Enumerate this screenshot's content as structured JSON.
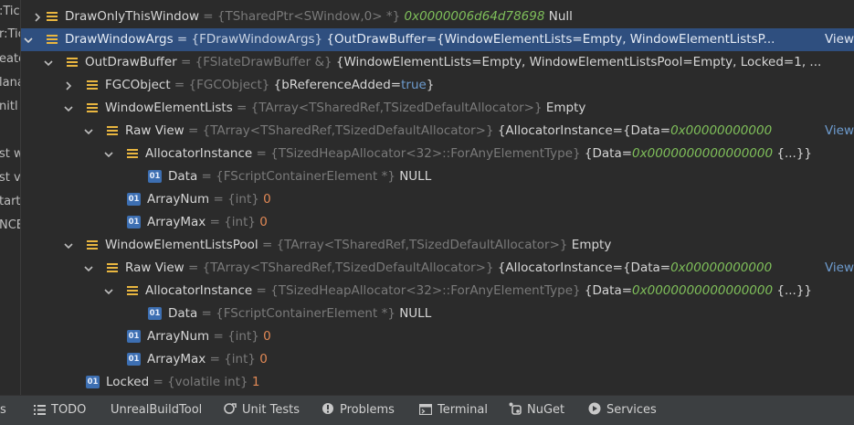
{
  "gutter": [
    ":Tic",
    "r:Tic",
    "eate",
    "lana",
    "nitl",
    "st w",
    "st v",
    "tart",
    "NCE"
  ],
  "rows": [
    {
      "id": "r0",
      "name": "DrawOnlyThisWindow",
      "type": "{TSharedPtr<SWindow,0> *}",
      "addr": "0x0000006d64d78698",
      "value": " Null"
    },
    {
      "id": "r1",
      "name": "DrawWindowArgs",
      "type": "{FDrawWindowArgs}",
      "value": " {OutDrawBuffer={WindowElementLists=Empty, WindowElementListsP...",
      "link": "View"
    },
    {
      "id": "r2",
      "name": "OutDrawBuffer",
      "type": "{FSlateDrawBuffer &}",
      "value": " {WindowElementLists=Empty, WindowElementListsPool=Empty, Locked=1, ..."
    },
    {
      "id": "r3",
      "name": "FGCObject",
      "type": "{FGCObject}",
      "value": " {bReferenceAdded=",
      "kw": "true",
      "value2": "}"
    },
    {
      "id": "r4",
      "name": "WindowElementLists",
      "type": "{TArray<TSharedRef,TSizedDefaultAllocator>}",
      "value": " Empty"
    },
    {
      "id": "r5",
      "name": "Raw View",
      "type": "{TArray<TSharedRef,TSizedDefaultAllocator>}",
      "value": " {AllocatorInstance={Data=",
      "addr": "0x00000000000",
      "link": "View"
    },
    {
      "id": "r6",
      "name": "AllocatorInstance",
      "type": "{TSizedHeapAllocator<32>::ForAnyElementType}",
      "value": " {Data=",
      "addr": "0x0000000000000000",
      "value2": " {...}}"
    },
    {
      "id": "r7",
      "name": "Data",
      "type": "{FScriptContainerElement *}",
      "value": " NULL"
    },
    {
      "id": "r8",
      "name": "ArrayNum",
      "type": "{int}",
      "num": "0"
    },
    {
      "id": "r9",
      "name": "ArrayMax",
      "type": "{int}",
      "num": "0"
    },
    {
      "id": "r10",
      "name": "WindowElementListsPool",
      "type": "{TArray<TSharedRef,TSizedDefaultAllocator>}",
      "value": " Empty"
    },
    {
      "id": "r11",
      "name": "Raw View",
      "type": "{TArray<TSharedRef,TSizedDefaultAllocator>}",
      "value": " {AllocatorInstance={Data=",
      "addr": "0x00000000000",
      "link": "View"
    },
    {
      "id": "r12",
      "name": "AllocatorInstance",
      "type": "{TSizedHeapAllocator<32>::ForAnyElementType}",
      "value": " {Data=",
      "addr": "0x0000000000000000",
      "value2": " {...}}"
    },
    {
      "id": "r13",
      "name": "Data",
      "type": "{FScriptContainerElement *}",
      "value": " NULL"
    },
    {
      "id": "r14",
      "name": "ArrayNum",
      "type": "{int}",
      "num": "0"
    },
    {
      "id": "r15",
      "name": "ArrayMax",
      "type": "{int}",
      "num": "0"
    },
    {
      "id": "r16",
      "name": "Locked",
      "type": "{volatile int}",
      "num": "1"
    }
  ],
  "eq": " = ",
  "toolwindows": [
    {
      "label": "s",
      "icon": ""
    },
    {
      "label": "TODO",
      "icon": "todo-list-icon"
    },
    {
      "label": "UnrealBuildTool",
      "icon": ""
    },
    {
      "label": "Unit Tests",
      "icon": "unit-tests-icon"
    },
    {
      "label": "Problems",
      "icon": "problems-icon"
    },
    {
      "label": "Terminal",
      "icon": "terminal-icon"
    },
    {
      "label": "NuGet",
      "icon": "nuget-icon"
    },
    {
      "label": "Services",
      "icon": "services-icon"
    }
  ],
  "colors": {
    "background": "#2b2b2b",
    "selection": "#2f4f7f",
    "field_icon": "#e9b640",
    "primitive_icon": "#3d6fb2",
    "address": "#7fbf5a",
    "number": "#e08855",
    "keyword": "#6e9ccf",
    "type": "#7a7a7a"
  }
}
